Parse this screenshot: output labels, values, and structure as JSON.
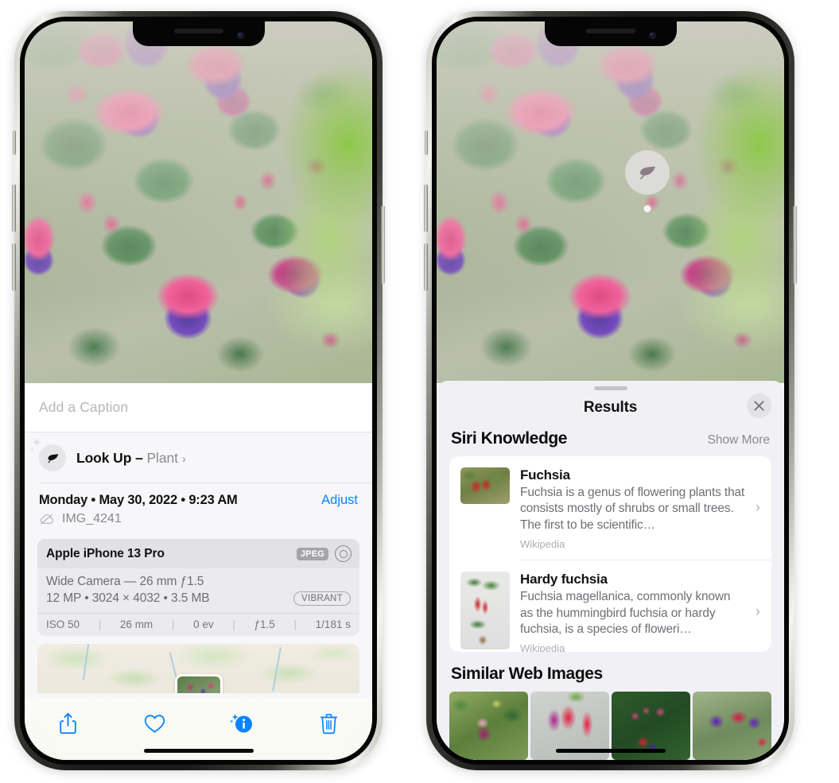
{
  "left_phone": {
    "caption_placeholder": "Add a Caption",
    "lookup": {
      "label": "Look Up",
      "dash": "–",
      "subject": "Plant",
      "chevron": "›",
      "icon": "leaf-icon"
    },
    "meta": {
      "date": "Monday • May 30, 2022 • 9:23 AM",
      "adjust_label": "Adjust",
      "filename": "IMG_4241",
      "cloud_icon": "cloud-slash-icon"
    },
    "camera": {
      "model": "Apple iPhone 13 Pro",
      "format_badge": "JPEG",
      "raw_icon": "raw-ring-icon",
      "lens_line": "Wide Camera — 26 mm ƒ1.5",
      "spec_line": "12 MP • 3024 × 4032 • 3.5 MB",
      "style_badge": "VIBRANT",
      "exif": [
        "ISO 50",
        "26 mm",
        "0 ev",
        "ƒ1.5",
        "1/181 s"
      ]
    },
    "toolbar": {
      "share_label": "share-button",
      "favorite_label": "favorite-button",
      "info_label": "info-button",
      "delete_label": "delete-button"
    }
  },
  "right_phone": {
    "badge_icon": "leaf-icon",
    "sheet": {
      "title": "Results",
      "close_label": "✕"
    },
    "siri_knowledge": {
      "heading": "Siri Knowledge",
      "show_more": "Show More",
      "items": [
        {
          "title": "Fuchsia",
          "description": "Fuchsia is a genus of flowering plants that consists mostly of shrubs or small trees. The first to be scientific…",
          "source": "Wikipedia",
          "chevron": "›"
        },
        {
          "title": "Hardy fuchsia",
          "description": "Fuchsia magellanica, commonly known as the hummingbird fuchsia or hardy fuchsia, is a species of floweri…",
          "source": "Wikipedia",
          "chevron": "›"
        }
      ]
    },
    "similar_web_images": {
      "heading": "Similar Web Images",
      "count": 4
    }
  },
  "colors": {
    "accent_blue": "#0a84ff",
    "sheet_bg": "#f1f1f5",
    "card_bg": "#ffffff",
    "secondary_text": "#8a8a8f"
  }
}
